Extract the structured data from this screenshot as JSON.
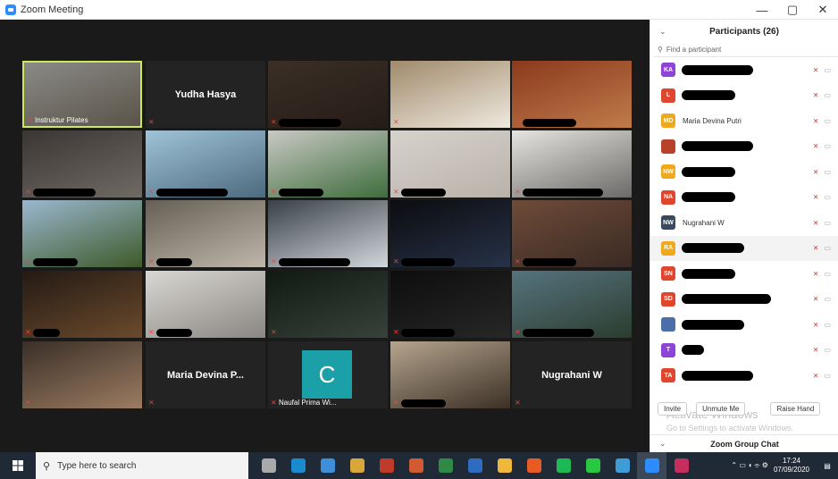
{
  "window": {
    "title": "Zoom Meeting",
    "minimize": "—",
    "restore": "▢",
    "close": "✕"
  },
  "gallery": {
    "tiles": [
      {
        "name": "Instruktur Pilates",
        "type": "video",
        "active": true,
        "c1": "#8a8a86",
        "c2": "#5a5448"
      },
      {
        "big": "Yudha Hasya",
        "type": "name"
      },
      {
        "type": "video",
        "redact": 70,
        "c1": "#3b2f26",
        "c2": "#251c16"
      },
      {
        "type": "video",
        "redact": 0,
        "c1": "#a08a6b",
        "c2": "#efe9df"
      },
      {
        "type": "video",
        "redact": 60,
        "c1": "#8b3a1d",
        "c2": "#c07b4a"
      },
      {
        "type": "video",
        "redact": 70,
        "c1": "#3b3634",
        "c2": "#6f6a63"
      },
      {
        "type": "video",
        "redact": 80,
        "c1": "#9fc3d8",
        "c2": "#4d6a7e"
      },
      {
        "type": "video",
        "redact": 50,
        "c1": "#c9c9c4",
        "c2": "#3e6d3c"
      },
      {
        "type": "video",
        "redact": 50,
        "c1": "#d6d2cc",
        "c2": "#b9b2aa"
      },
      {
        "type": "video",
        "redact": 90,
        "c1": "#e6e4e0",
        "c2": "#6c6a68"
      },
      {
        "type": "video",
        "redact": 50,
        "c1": "#9bb7cf",
        "c2": "#3d5a2a"
      },
      {
        "type": "video",
        "redact": 40,
        "c1": "#665f55",
        "c2": "#bfb7aa"
      },
      {
        "type": "video",
        "redact": 80,
        "c1": "#384048",
        "c2": "#d2d7db"
      },
      {
        "type": "video",
        "redact": 60,
        "c1": "#0c0c10",
        "c2": "#263247"
      },
      {
        "type": "video",
        "redact": 60,
        "c1": "#6e4b38",
        "c2": "#3a2a24"
      },
      {
        "type": "video",
        "redact": 30,
        "c1": "#231a14",
        "c2": "#6b4a2c"
      },
      {
        "type": "video",
        "redact": 40,
        "c1": "#d9d7d3",
        "c2": "#8a8782"
      },
      {
        "type": "video",
        "redact": 0,
        "c1": "#0f1a12",
        "c2": "#39423a"
      },
      {
        "type": "video",
        "redact": 60,
        "c1": "#0d0d0d",
        "c2": "#272727"
      },
      {
        "type": "video",
        "redact": 80,
        "c1": "#55737e",
        "c2": "#2c3d2f"
      },
      {
        "type": "video",
        "redact": 0,
        "c1": "#3a2f27",
        "c2": "#9c7c62"
      },
      {
        "big": "Maria Devina P...",
        "type": "name"
      },
      {
        "type": "avatar",
        "letter": "C",
        "name": "Naufal Prima Wi..."
      },
      {
        "type": "video",
        "redact": 50,
        "c1": "#b5a58e",
        "c2": "#3c3026"
      },
      {
        "big": "Nugrahani W",
        "type": "name"
      }
    ]
  },
  "participants": {
    "header": "Participants (26)",
    "search_placeholder": "Find a participant",
    "list": [
      {
        "initials": "KA",
        "color": "#8e44d6",
        "name": "",
        "redact": 80
      },
      {
        "initials": "L",
        "color": "#e0452d",
        "name": "",
        "redact": 60
      },
      {
        "initials": "MD",
        "color": "#f0a81c",
        "name": "Maria Devina Putri",
        "redact": 0
      },
      {
        "initials": "",
        "color": "#b8412b",
        "name": "",
        "redact": 80
      },
      {
        "initials": "NW",
        "color": "#f0a81c",
        "name": "",
        "redact": 60
      },
      {
        "initials": "NA",
        "color": "#e0452d",
        "name": "",
        "redact": 60
      },
      {
        "initials": "NW",
        "color": "#3a4a5e",
        "name": "Nugrahani W",
        "redact": 0
      },
      {
        "initials": "RA",
        "color": "#f0a81c",
        "name": "",
        "redact": 70,
        "hl": true
      },
      {
        "initials": "SN",
        "color": "#e0452d",
        "name": "",
        "redact": 60
      },
      {
        "initials": "SD",
        "color": "#e0452d",
        "name": "",
        "redact": 100
      },
      {
        "initials": "",
        "color": "#4a6ea8",
        "name": "",
        "redact": 70
      },
      {
        "initials": "T",
        "color": "#8e44d6",
        "name": "",
        "redact": 25
      },
      {
        "initials": "TA",
        "color": "#e0452d",
        "name": "",
        "redact": 80
      }
    ],
    "buttons": {
      "invite": "Invite",
      "unmute": "Unmute Me",
      "raise": "Raise Hand"
    },
    "watermark": "Activate Windows",
    "watermark_sub": "Go to Settings to activate Windows.",
    "chat": "Zoom Group Chat"
  },
  "taskbar": {
    "search": "Type here to search",
    "apps": [
      "#aaa",
      "#1b8bd1",
      "#3d8fd9",
      "#d9a63a",
      "#c13b2b",
      "#d15a33",
      "#2f8a46",
      "#2d6cc1",
      "#f0b73a",
      "#e85b22",
      "#1db954",
      "#28c840",
      "#3e9dd8",
      "#2d8cff",
      "#c62f5d"
    ],
    "time": "17:24",
    "date": "07/09/2020"
  }
}
